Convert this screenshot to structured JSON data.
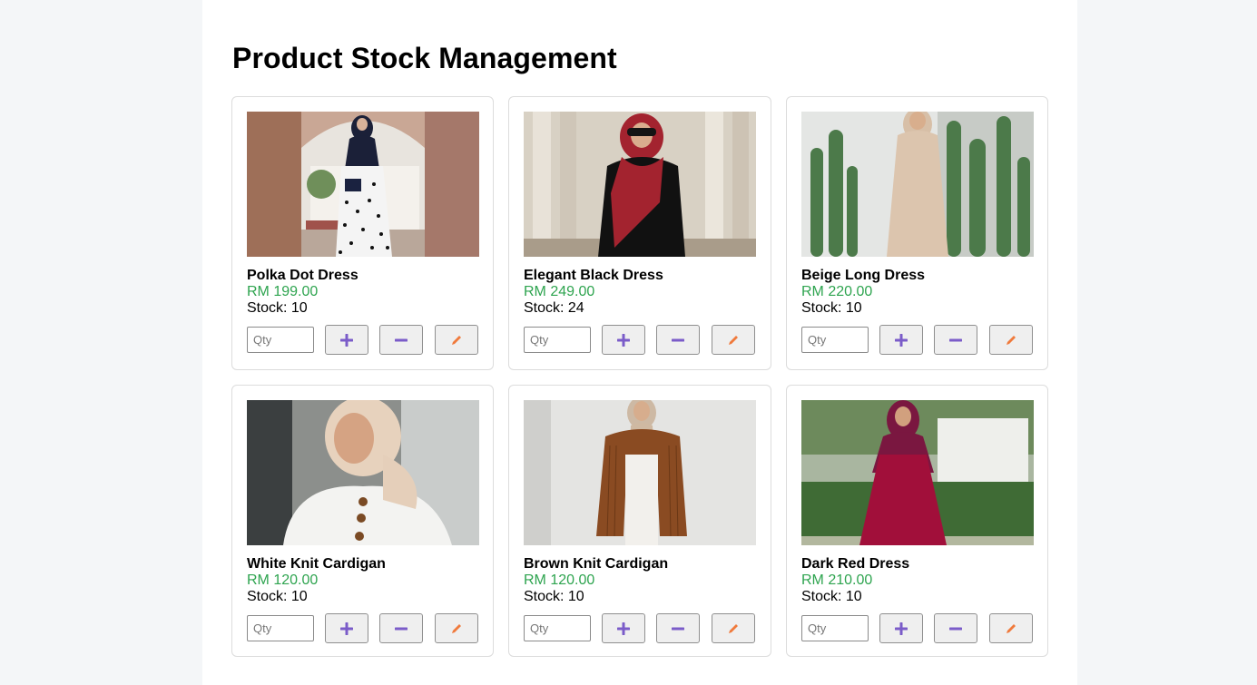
{
  "page": {
    "title": "Product Stock Management"
  },
  "colors": {
    "price": "#2ea44f",
    "add_icon": "#7b5cc9",
    "minus_icon": "#7b5cc9",
    "edit_icon": "#f07a3c"
  },
  "qty_placeholder": "Qty",
  "products": [
    {
      "name": "Polka Dot Dress",
      "price": "RM 199.00",
      "stock": "Stock: 10",
      "image": "woman-hijab-polka-dot-dress"
    },
    {
      "name": "Elegant Black Dress",
      "price": "RM 249.00",
      "stock": "Stock: 24",
      "image": "woman-red-hijab-black-dress"
    },
    {
      "name": "Beige Long Dress",
      "price": "RM 220.00",
      "stock": "Stock: 10",
      "image": "woman-beige-dress-cactus"
    },
    {
      "name": "White Knit Cardigan",
      "price": "RM 120.00",
      "stock": "Stock: 10",
      "image": "woman-white-knit-cardigan"
    },
    {
      "name": "Brown Knit Cardigan",
      "price": "RM 120.00",
      "stock": "Stock: 10",
      "image": "woman-brown-knit-cardigan"
    },
    {
      "name": "Dark Red Dress",
      "price": "RM 210.00",
      "stock": "Stock: 10",
      "image": "woman-dark-red-dress-garden"
    }
  ],
  "icons": {
    "add": "plus-icon",
    "minus": "minus-icon",
    "edit": "pencil-icon"
  }
}
